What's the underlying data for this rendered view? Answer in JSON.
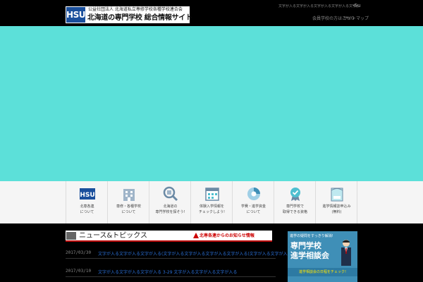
{
  "header": {
    "logo_mark": "HSU",
    "logo_org": "公益社団法人 北海道私立専修学校各種学校連合会",
    "logo_title": "北海道の専門学校 総合情報サイト",
    "notice": "文字が入る文字が入る文字が入る文字が入る文字が入る文字が入る文字が入る文字",
    "notice_tail": "-Su",
    "links": [
      "会員学校の方はこちら",
      "サイトマップ"
    ]
  },
  "nav": {
    "items": [
      {
        "label": "北専各連\nについて",
        "icon": "hsu-logo-icon"
      },
      {
        "label": "専修・各種学校\nについて",
        "icon": "building-icon"
      },
      {
        "label": "北海道の\n専門学校を探そう!",
        "icon": "search-building-icon"
      },
      {
        "label": "体験入学情報を\nチェックしよう!",
        "icon": "calendar-icon"
      },
      {
        "label": "学費・進学資金\nについて",
        "icon": "pie-chart-icon"
      },
      {
        "label": "専門学校で\n取得できる資格",
        "icon": "badge-icon"
      },
      {
        "label": "進学情報誌申込み\n(無料)",
        "icon": "magazine-icon"
      }
    ]
  },
  "news": {
    "title": "ニュース&トピックス",
    "subtitle": "北専各連からのお知らせ情報",
    "items": [
      {
        "date": "2017/03/30",
        "text": "文字が入る文字が入る文字が入る(文字が入る文字が入る文字が入る文字が入る)文字が入る文字が入る文字"
      },
      {
        "date": "2017/03/10",
        "text": "文字が入る文字が入る文字が入る 3-29 文字が入る文字が入る文字が入る"
      }
    ]
  },
  "banner": {
    "top": "進学の疑問をすっきり解消!",
    "title_1": "専門学校",
    "title_2": "進学相談会",
    "bottom": "進学相談会の日程をチェック!"
  },
  "colors": {
    "hero": "#5ce0d9",
    "accent": "#c00000",
    "link": "#2a6fd6",
    "banner": "#3f8fb7"
  }
}
